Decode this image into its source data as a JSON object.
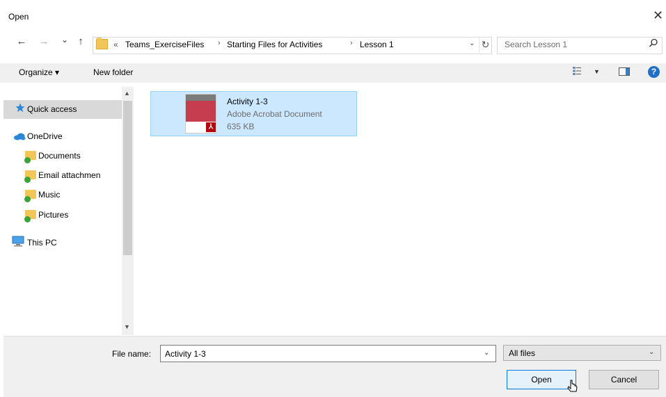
{
  "window": {
    "title": "Open",
    "close_glyph": "✕"
  },
  "nav": {
    "back_glyph": "←",
    "forward_glyph": "→",
    "recent_glyph": "⌄",
    "up_glyph": "↑"
  },
  "address": {
    "overflow": "«",
    "crumbs": [
      "Teams_ExerciseFiles",
      "Starting Files for Activities",
      "Lesson 1"
    ],
    "separator": "›",
    "dropdown_glyph": "⌄",
    "refresh_glyph": "↻"
  },
  "search": {
    "placeholder": "Search Lesson 1",
    "icon": "search-icon"
  },
  "toolbar": {
    "organize_label": "Organize ▾",
    "new_folder_label": "New folder",
    "views_dropdown": "▼",
    "help_label": "?"
  },
  "sidebar": {
    "scroll_up": "▲",
    "scroll_down": "▼",
    "items": [
      {
        "label": "Quick access",
        "icon": "star-icon"
      },
      {
        "label": "OneDrive",
        "icon": "cloud-icon"
      },
      {
        "label": "Documents",
        "icon": "folder-icon"
      },
      {
        "label": "Email attachmen",
        "icon": "folder-icon"
      },
      {
        "label": "Music",
        "icon": "folder-icon"
      },
      {
        "label": "Pictures",
        "icon": "folder-icon"
      },
      {
        "label": "This PC",
        "icon": "computer-icon"
      }
    ]
  },
  "files": [
    {
      "name": "Activity 1-3",
      "type": "Adobe Acrobat Document",
      "size": "635 KB",
      "selected": true
    }
  ],
  "footer": {
    "file_name_label": "File name:",
    "file_name_value": "Activity 1-3",
    "file_type_value": "All files",
    "dropdown_glyph": "⌄",
    "open_label": "Open",
    "cancel_label": "Cancel"
  },
  "colors": {
    "selection": "#cce8ff",
    "selection_border": "#99d1ff",
    "accent": "#0078d7",
    "folder": "#f3c65a"
  }
}
